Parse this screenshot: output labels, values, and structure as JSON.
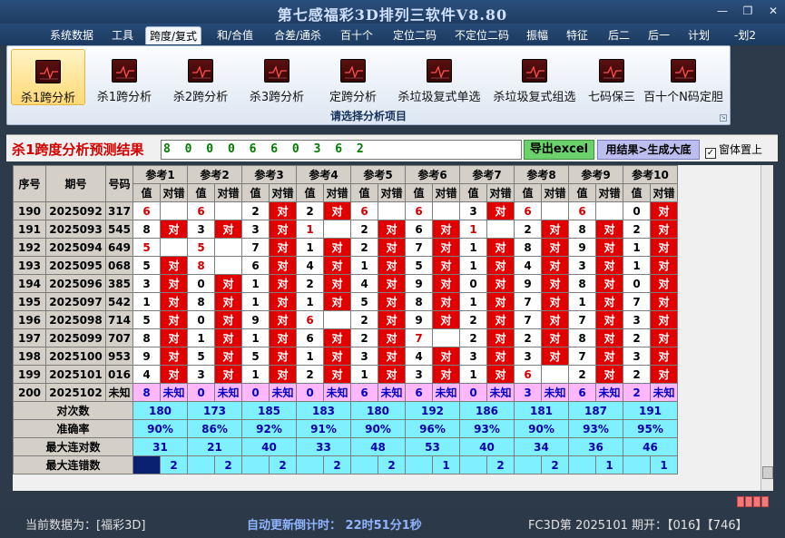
{
  "window": {
    "title": "第七感福彩3D排列三软件V8.80",
    "minimize": "—",
    "restore": "❐",
    "close": "✕"
  },
  "menu": [
    "系统数据",
    "工具",
    "跨度/复式",
    "和/合值",
    "合差/通杀",
    "百十个",
    "定位二码",
    "不定位二码",
    "振幅",
    "特征",
    "后二",
    "后一",
    "计划",
    "-划2"
  ],
  "menu_active": 2,
  "ribbon": {
    "buttons": [
      "杀1跨分析",
      "杀1跨分析",
      "杀2跨分析",
      "杀3跨分析",
      "定跨分析",
      "杀垃圾复式单选",
      "杀垃圾复式组选",
      "七码保三",
      "百十个N码定胆"
    ],
    "selected": 0,
    "group_label": "请选择分析项目",
    "icon": "chart-icon"
  },
  "result": {
    "title": "杀1跨度分析预测结果",
    "digits": "8 0 0 0 6 6 0 3 6 2",
    "excel_button": "导出excel",
    "generate_button": "用结果>生成大底",
    "topmost_label": "窗体置上",
    "topmost_checked": "✓"
  },
  "grid": {
    "h_seq": "序号",
    "h_period": "期号",
    "h_code": "号码",
    "ref_headers": [
      "参考1",
      "参考2",
      "参考3",
      "参考4",
      "参考5",
      "参考6",
      "参考7",
      "参考8",
      "参考9",
      "参考10"
    ],
    "sub_val": "值",
    "sub_mark": "对错",
    "mark_text": "对",
    "unknown_text": "未知",
    "rows": [
      {
        "seq": "190",
        "period": "2025092",
        "code": "317",
        "vals": [
          "6",
          "6",
          "2",
          "2",
          "6",
          "6",
          "3",
          "6",
          "6",
          "0"
        ],
        "marks": [
          0,
          0,
          1,
          1,
          0,
          0,
          1,
          0,
          0,
          1
        ],
        "red": [
          1,
          1,
          0,
          0,
          1,
          1,
          0,
          1,
          1,
          0
        ]
      },
      {
        "seq": "191",
        "period": "2025093",
        "code": "545",
        "vals": [
          "8",
          "3",
          "3",
          "1",
          "2",
          "6",
          "1",
          "2",
          "8",
          "2"
        ],
        "marks": [
          1,
          1,
          1,
          0,
          1,
          1,
          0,
          1,
          1,
          1
        ],
        "red": [
          0,
          0,
          0,
          1,
          0,
          0,
          1,
          0,
          0,
          0
        ]
      },
      {
        "seq": "192",
        "period": "2025094",
        "code": "649",
        "vals": [
          "5",
          "5",
          "7",
          "1",
          "2",
          "7",
          "1",
          "8",
          "9",
          "1"
        ],
        "marks": [
          0,
          0,
          1,
          1,
          1,
          1,
          1,
          1,
          1,
          1
        ],
        "red": [
          1,
          1,
          0,
          0,
          0,
          0,
          0,
          0,
          0,
          0
        ]
      },
      {
        "seq": "193",
        "period": "2025095",
        "code": "068",
        "vals": [
          "5",
          "8",
          "6",
          "4",
          "1",
          "5",
          "1",
          "4",
          "3",
          "1"
        ],
        "marks": [
          1,
          0,
          1,
          1,
          1,
          1,
          1,
          1,
          1,
          1
        ],
        "red": [
          0,
          1,
          0,
          0,
          0,
          0,
          0,
          0,
          0,
          0
        ]
      },
      {
        "seq": "194",
        "period": "2025096",
        "code": "385",
        "vals": [
          "3",
          "0",
          "1",
          "2",
          "4",
          "9",
          "0",
          "9",
          "8",
          "0"
        ],
        "marks": [
          1,
          1,
          1,
          1,
          1,
          1,
          1,
          1,
          1,
          1
        ],
        "red": [
          0,
          0,
          0,
          0,
          0,
          0,
          0,
          0,
          0,
          0
        ]
      },
      {
        "seq": "195",
        "period": "2025097",
        "code": "542",
        "vals": [
          "1",
          "8",
          "1",
          "1",
          "5",
          "8",
          "1",
          "7",
          "1",
          "7"
        ],
        "marks": [
          1,
          1,
          1,
          1,
          1,
          1,
          1,
          1,
          1,
          1
        ],
        "red": [
          0,
          0,
          0,
          0,
          0,
          0,
          0,
          0,
          0,
          0
        ]
      },
      {
        "seq": "196",
        "period": "2025098",
        "code": "714",
        "vals": [
          "5",
          "0",
          "9",
          "6",
          "2",
          "9",
          "2",
          "7",
          "7",
          "3"
        ],
        "marks": [
          1,
          1,
          1,
          0,
          1,
          1,
          1,
          1,
          1,
          1
        ],
        "red": [
          0,
          0,
          0,
          1,
          0,
          0,
          0,
          0,
          0,
          0
        ]
      },
      {
        "seq": "197",
        "period": "2025099",
        "code": "707",
        "vals": [
          "8",
          "1",
          "1",
          "6",
          "2",
          "7",
          "2",
          "2",
          "8",
          "2"
        ],
        "marks": [
          1,
          1,
          1,
          1,
          1,
          0,
          1,
          1,
          1,
          1
        ],
        "red": [
          0,
          0,
          0,
          0,
          0,
          1,
          0,
          0,
          0,
          0
        ]
      },
      {
        "seq": "198",
        "period": "2025100",
        "code": "953",
        "vals": [
          "9",
          "5",
          "5",
          "1",
          "3",
          "4",
          "3",
          "3",
          "7",
          "3"
        ],
        "marks": [
          1,
          1,
          1,
          1,
          1,
          1,
          1,
          1,
          1,
          1
        ],
        "red": [
          0,
          0,
          0,
          0,
          0,
          0,
          0,
          0,
          0,
          0
        ]
      },
      {
        "seq": "199",
        "period": "2025101",
        "code": "016",
        "vals": [
          "4",
          "3",
          "1",
          "2",
          "1",
          "3",
          "1",
          "6",
          "2",
          "2"
        ],
        "marks": [
          1,
          1,
          1,
          1,
          1,
          1,
          1,
          0,
          1,
          1
        ],
        "red": [
          0,
          0,
          0,
          0,
          0,
          0,
          0,
          1,
          0,
          0
        ]
      },
      {
        "seq": "200",
        "period": "2025102",
        "code": "未知",
        "vals": [
          "8",
          "0",
          "0",
          "0",
          "6",
          "6",
          "0",
          "3",
          "6",
          "2"
        ]
      }
    ],
    "stats": [
      {
        "label": "对次数",
        "values": [
          "180",
          "173",
          "185",
          "183",
          "180",
          "192",
          "186",
          "181",
          "187",
          "191"
        ]
      },
      {
        "label": "准确率",
        "values": [
          "90%",
          "86%",
          "92%",
          "91%",
          "90%",
          "96%",
          "93%",
          "90%",
          "93%",
          "95%"
        ]
      },
      {
        "label": "最大连对数",
        "values": [
          "31",
          "21",
          "40",
          "33",
          "48",
          "53",
          "40",
          "34",
          "36",
          "46"
        ]
      },
      {
        "label": "最大连错数",
        "values": [
          "2",
          "2",
          "2",
          "2",
          "2",
          "1",
          "2",
          "2",
          "1",
          "1"
        ]
      }
    ]
  },
  "status": {
    "data_source": "当前数据为：[福彩3D]",
    "countdown": "自动更新倒计时：  22时51分1秒",
    "draw_info": "FC3D第 2025101 期开：【016】【746】"
  }
}
